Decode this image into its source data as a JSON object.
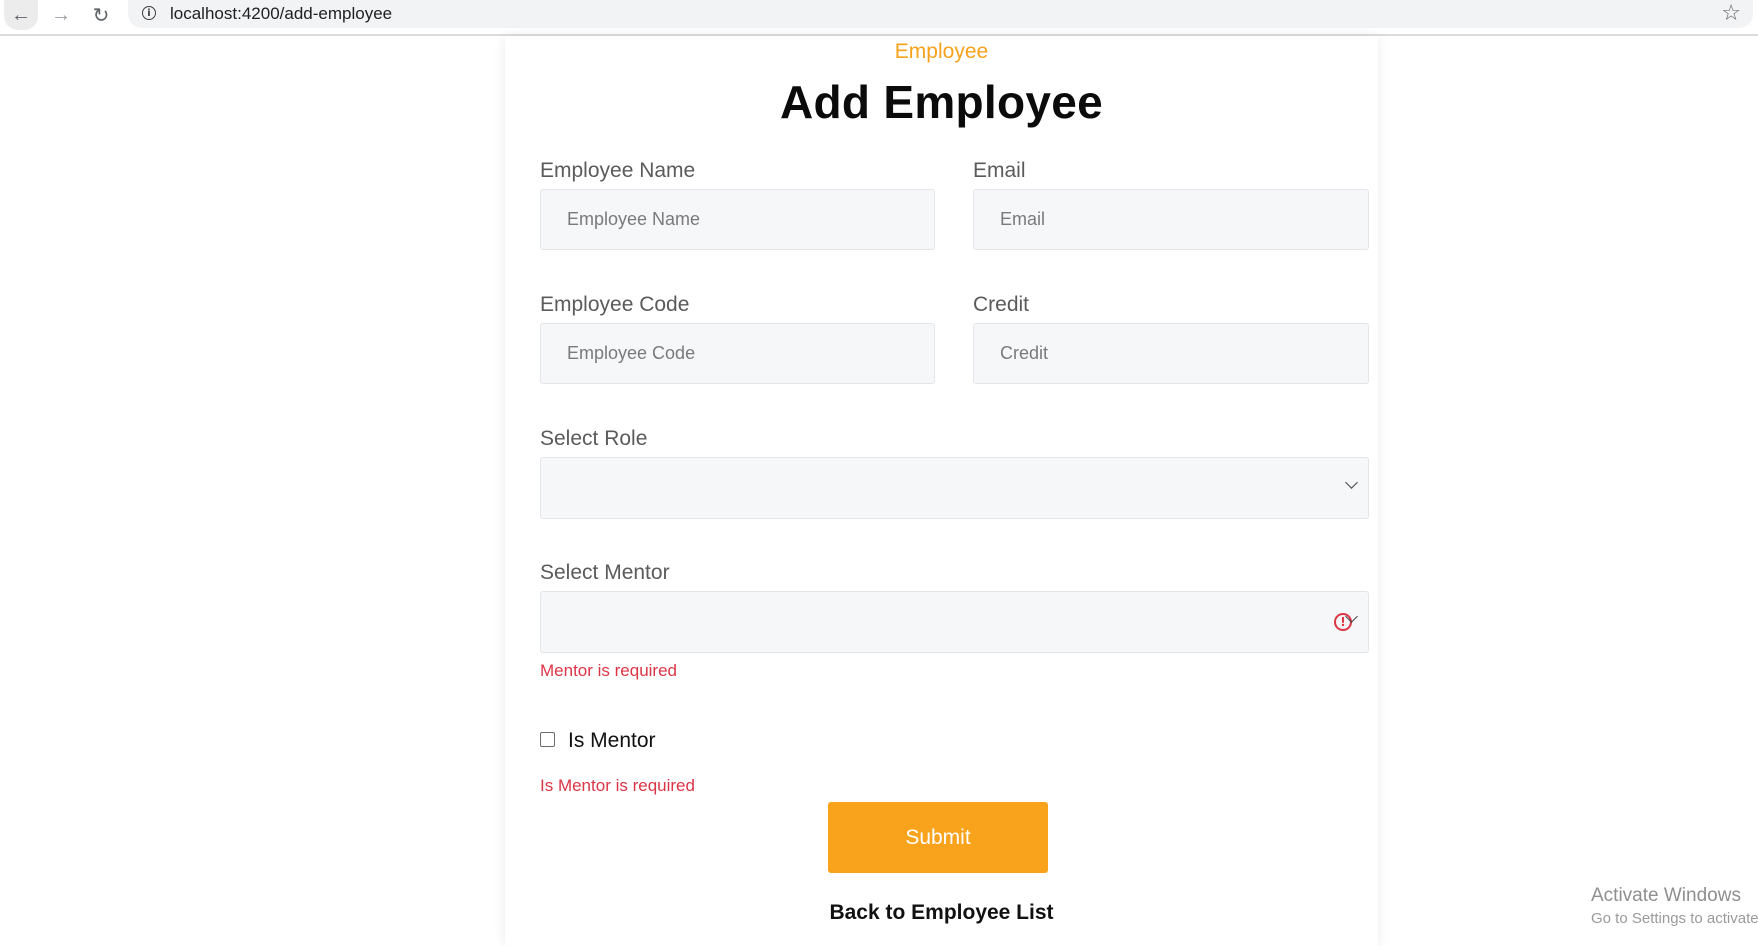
{
  "browser": {
    "url_host": "localhost",
    "url_rest": ":4200/add-employee",
    "back_glyph": "←",
    "forward_glyph": "→",
    "reload_glyph": "↻",
    "star_glyph": "☆"
  },
  "page": {
    "eyebrow": "Employee",
    "title": "Add Employee"
  },
  "form": {
    "employee_name": {
      "label": "Employee Name",
      "placeholder": "Employee Name",
      "value": ""
    },
    "email": {
      "label": "Email",
      "placeholder": "Email",
      "value": ""
    },
    "employee_code": {
      "label": "Employee Code",
      "placeholder": "Employee Code",
      "value": ""
    },
    "credit": {
      "label": "Credit",
      "placeholder": "Credit",
      "value": ""
    },
    "role": {
      "label": "Select Role",
      "selected": ""
    },
    "mentor": {
      "label": "Select Mentor",
      "selected": "",
      "error": "Mentor is required"
    },
    "is_mentor": {
      "label": "Is Mentor",
      "checked": false,
      "error": "Is Mentor is required"
    },
    "submit_label": "Submit",
    "back_link": "Back to Employee List"
  },
  "watermark": {
    "title": "Activate Windows",
    "subtitle": "Go to Settings to activate Windows."
  },
  "colors": {
    "accent": "#f9a21b",
    "error": "#dc3545",
    "field_bg": "#f6f7f9"
  }
}
